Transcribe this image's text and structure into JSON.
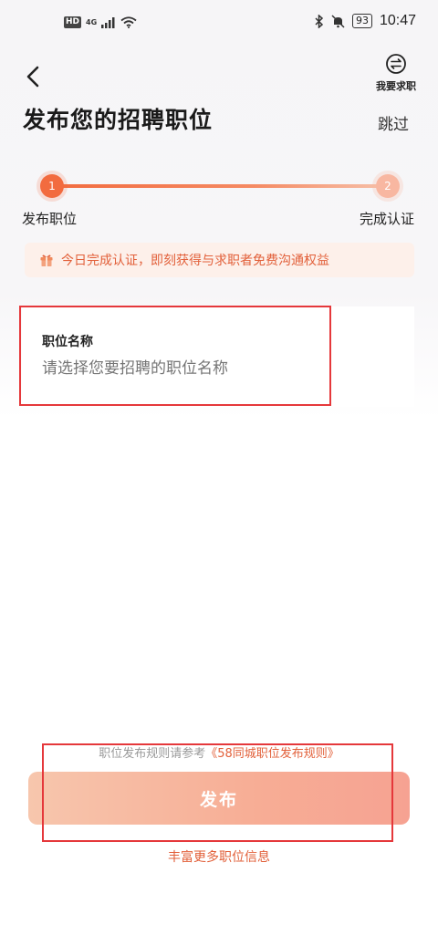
{
  "status_bar": {
    "hd": "HD",
    "network": "4G",
    "battery": "93",
    "time": "10:47"
  },
  "header": {
    "back_icon": "chevron-left-icon",
    "switch_icon": "swap-icon",
    "switch_label": "我要求职",
    "title": "发布您的招聘职位",
    "skip_label": "跳过"
  },
  "steps": [
    {
      "number": "1",
      "label": "发布职位",
      "state": "active"
    },
    {
      "number": "2",
      "label": "完成认证",
      "state": "pending"
    }
  ],
  "promo": {
    "icon": "gift-icon",
    "text": "今日完成认证，即刻获得与求职者免费沟通权益"
  },
  "form": {
    "position_label": "职位名称",
    "position_placeholder": "请选择您要招聘的职位名称"
  },
  "footer": {
    "rules_prefix": "职位发布规则请参考",
    "rules_link": "《58同城职位发布规则》",
    "publish_label": "发布",
    "more_info": "丰富更多职位信息"
  },
  "colors": {
    "accent": "#f26b3f",
    "highlight": "#e5383b",
    "link": "#e2603a"
  }
}
